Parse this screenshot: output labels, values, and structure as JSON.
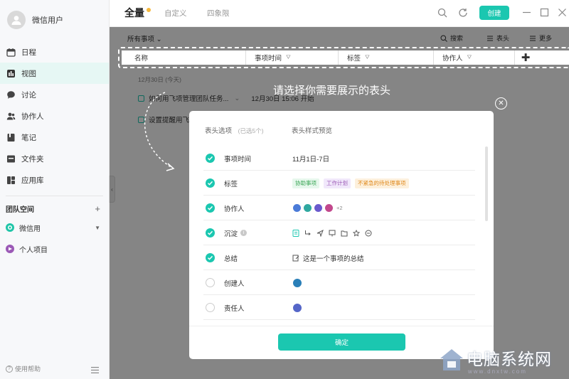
{
  "sidebar": {
    "user_name": "微信用户",
    "nav": [
      {
        "label": "日程",
        "icon": "calendar-icon"
      },
      {
        "label": "视图",
        "icon": "chart-icon"
      },
      {
        "label": "讨论",
        "icon": "chat-icon"
      },
      {
        "label": "协作人",
        "icon": "people-icon"
      },
      {
        "label": "笔记",
        "icon": "note-icon"
      },
      {
        "label": "文件夹",
        "icon": "folder-icon"
      },
      {
        "label": "应用库",
        "icon": "grid-icon"
      }
    ],
    "team_title": "团队空间",
    "team_plus": "+",
    "teams": [
      {
        "label": "微信用",
        "color": "#20c5a8"
      },
      {
        "label": "个人项目",
        "color": "#9b59b6"
      }
    ],
    "help_label": "使用帮助"
  },
  "topbar": {
    "tabs": [
      "全量",
      "自定义",
      "四象限"
    ],
    "create_label": "创建"
  },
  "filterbar": {
    "all_items": "所有事项",
    "search": "搜索",
    "header": "表头",
    "more": "更多"
  },
  "table_header": {
    "columns": [
      "名称",
      "事项时间",
      "标签",
      "协作人"
    ],
    "add": "✚"
  },
  "tasks": {
    "date_head": "12月30日 (今天)",
    "rows": [
      {
        "title": "如何用飞项管理团队任务...",
        "time": "12月30日 15:06 开始"
      },
      {
        "title": "设置提醒用飞"
      }
    ]
  },
  "hint_text": "请选择你需要展示的表头",
  "modal": {
    "col_options": "表头选项",
    "selected_count": "(已选5个)",
    "col_preview": "表头样式预览",
    "options": [
      {
        "label": "事项时间",
        "checked": true,
        "preview": "11月1日-7日"
      },
      {
        "label": "标签",
        "checked": true,
        "tags": [
          "协助事项",
          "工作计划",
          "不紧急的待处理事项"
        ]
      },
      {
        "label": "协作人",
        "checked": true,
        "extra": "+2"
      },
      {
        "label": "沉淀",
        "checked": true,
        "info": "i"
      },
      {
        "label": "总结",
        "checked": true,
        "preview": "这是一个事项的总结"
      },
      {
        "label": "创建人",
        "checked": false
      },
      {
        "label": "责任人",
        "checked": false
      }
    ],
    "confirm": "确定"
  },
  "colors": {
    "accent": "#1bc7b0",
    "tag_green_bg": "#e6f7ec",
    "tag_green_fg": "#3aa655",
    "tag_purple_bg": "#f1e8fb",
    "tag_purple_fg": "#9b59b6",
    "tag_orange_bg": "#fdf0dc",
    "tag_orange_fg": "#e08a1e"
  },
  "watermark": {
    "text": "电脑系统网",
    "url": "www.dnxtw.com"
  }
}
